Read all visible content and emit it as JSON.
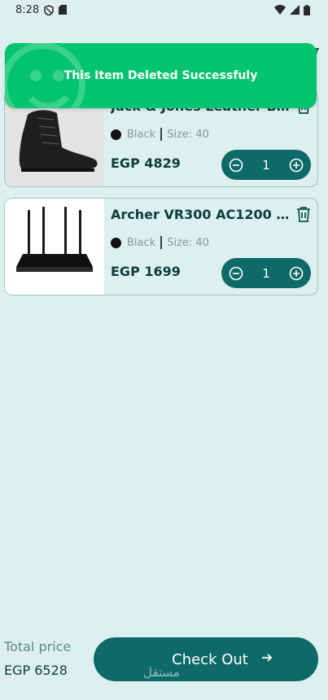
{
  "status_bar": {
    "time": "8:28"
  },
  "toast": {
    "message": "This Item Deleted Successfuly"
  },
  "cart": {
    "items": [
      {
        "title": "Jack & Jones Leather Boots",
        "color_name": "Black",
        "size_text": "Size: 40",
        "price": "EGP 4829",
        "quantity": "1",
        "color_hex": "#111111"
      },
      {
        "title": "Archer VR300 AC1200 Wi...",
        "color_name": "Black",
        "size_text": "Size: 40",
        "price": "EGP 1699",
        "quantity": "1",
        "color_hex": "#111111"
      }
    ]
  },
  "footer": {
    "total_label": "Total price",
    "total_value": "EGP 6528",
    "checkout_label": "Check Out",
    "watermark": "مستقل"
  },
  "colors": {
    "background": "#ddf0ef",
    "primary": "#0d6a68",
    "toast": "#03c46e",
    "text_dark": "#0c3d3d",
    "muted": "#7f9a9a"
  }
}
